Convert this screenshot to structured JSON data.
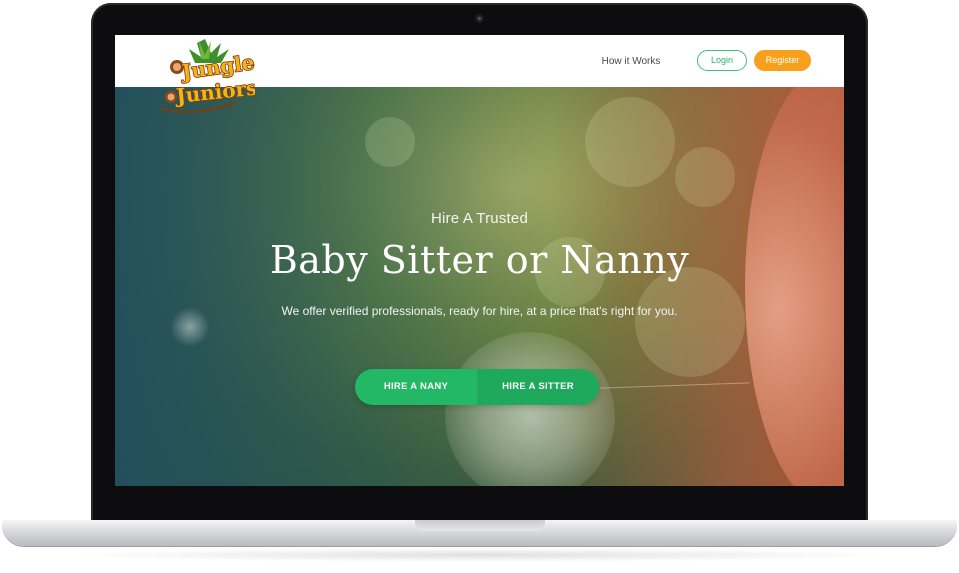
{
  "brand": {
    "logo_line1": "Jungle",
    "logo_line2": "Juniors",
    "colors": {
      "orange": "#f7a01b",
      "green": "#22b866",
      "brown": "#7a3d0c"
    }
  },
  "nav": {
    "how_it_works": "How it Works",
    "login": "Login",
    "register": "Register"
  },
  "hero": {
    "eyebrow": "Hire A Trusted",
    "title": "Baby Sitter or Nanny",
    "subtitle": "We offer verified professionals, ready for hire, at a price that's right for you.",
    "cta_left": "HIRE A NANY",
    "cta_right": "HIRE A SITTER"
  },
  "icons": [
    "camera-icon",
    "logo-icon"
  ]
}
